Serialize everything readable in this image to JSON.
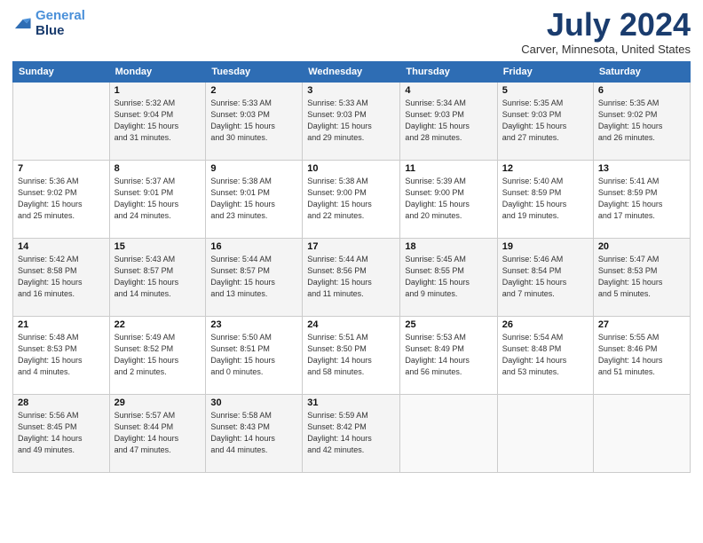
{
  "logo": {
    "line1": "General",
    "line2": "Blue"
  },
  "title": "July 2024",
  "subtitle": "Carver, Minnesota, United States",
  "headers": [
    "Sunday",
    "Monday",
    "Tuesday",
    "Wednesday",
    "Thursday",
    "Friday",
    "Saturday"
  ],
  "weeks": [
    [
      {
        "day": "",
        "info": ""
      },
      {
        "day": "1",
        "info": "Sunrise: 5:32 AM\nSunset: 9:04 PM\nDaylight: 15 hours\nand 31 minutes."
      },
      {
        "day": "2",
        "info": "Sunrise: 5:33 AM\nSunset: 9:03 PM\nDaylight: 15 hours\nand 30 minutes."
      },
      {
        "day": "3",
        "info": "Sunrise: 5:33 AM\nSunset: 9:03 PM\nDaylight: 15 hours\nand 29 minutes."
      },
      {
        "day": "4",
        "info": "Sunrise: 5:34 AM\nSunset: 9:03 PM\nDaylight: 15 hours\nand 28 minutes."
      },
      {
        "day": "5",
        "info": "Sunrise: 5:35 AM\nSunset: 9:03 PM\nDaylight: 15 hours\nand 27 minutes."
      },
      {
        "day": "6",
        "info": "Sunrise: 5:35 AM\nSunset: 9:02 PM\nDaylight: 15 hours\nand 26 minutes."
      }
    ],
    [
      {
        "day": "7",
        "info": "Sunrise: 5:36 AM\nSunset: 9:02 PM\nDaylight: 15 hours\nand 25 minutes."
      },
      {
        "day": "8",
        "info": "Sunrise: 5:37 AM\nSunset: 9:01 PM\nDaylight: 15 hours\nand 24 minutes."
      },
      {
        "day": "9",
        "info": "Sunrise: 5:38 AM\nSunset: 9:01 PM\nDaylight: 15 hours\nand 23 minutes."
      },
      {
        "day": "10",
        "info": "Sunrise: 5:38 AM\nSunset: 9:00 PM\nDaylight: 15 hours\nand 22 minutes."
      },
      {
        "day": "11",
        "info": "Sunrise: 5:39 AM\nSunset: 9:00 PM\nDaylight: 15 hours\nand 20 minutes."
      },
      {
        "day": "12",
        "info": "Sunrise: 5:40 AM\nSunset: 8:59 PM\nDaylight: 15 hours\nand 19 minutes."
      },
      {
        "day": "13",
        "info": "Sunrise: 5:41 AM\nSunset: 8:59 PM\nDaylight: 15 hours\nand 17 minutes."
      }
    ],
    [
      {
        "day": "14",
        "info": "Sunrise: 5:42 AM\nSunset: 8:58 PM\nDaylight: 15 hours\nand 16 minutes."
      },
      {
        "day": "15",
        "info": "Sunrise: 5:43 AM\nSunset: 8:57 PM\nDaylight: 15 hours\nand 14 minutes."
      },
      {
        "day": "16",
        "info": "Sunrise: 5:44 AM\nSunset: 8:57 PM\nDaylight: 15 hours\nand 13 minutes."
      },
      {
        "day": "17",
        "info": "Sunrise: 5:44 AM\nSunset: 8:56 PM\nDaylight: 15 hours\nand 11 minutes."
      },
      {
        "day": "18",
        "info": "Sunrise: 5:45 AM\nSunset: 8:55 PM\nDaylight: 15 hours\nand 9 minutes."
      },
      {
        "day": "19",
        "info": "Sunrise: 5:46 AM\nSunset: 8:54 PM\nDaylight: 15 hours\nand 7 minutes."
      },
      {
        "day": "20",
        "info": "Sunrise: 5:47 AM\nSunset: 8:53 PM\nDaylight: 15 hours\nand 5 minutes."
      }
    ],
    [
      {
        "day": "21",
        "info": "Sunrise: 5:48 AM\nSunset: 8:53 PM\nDaylight: 15 hours\nand 4 minutes."
      },
      {
        "day": "22",
        "info": "Sunrise: 5:49 AM\nSunset: 8:52 PM\nDaylight: 15 hours\nand 2 minutes."
      },
      {
        "day": "23",
        "info": "Sunrise: 5:50 AM\nSunset: 8:51 PM\nDaylight: 15 hours\nand 0 minutes."
      },
      {
        "day": "24",
        "info": "Sunrise: 5:51 AM\nSunset: 8:50 PM\nDaylight: 14 hours\nand 58 minutes."
      },
      {
        "day": "25",
        "info": "Sunrise: 5:53 AM\nSunset: 8:49 PM\nDaylight: 14 hours\nand 56 minutes."
      },
      {
        "day": "26",
        "info": "Sunrise: 5:54 AM\nSunset: 8:48 PM\nDaylight: 14 hours\nand 53 minutes."
      },
      {
        "day": "27",
        "info": "Sunrise: 5:55 AM\nSunset: 8:46 PM\nDaylight: 14 hours\nand 51 minutes."
      }
    ],
    [
      {
        "day": "28",
        "info": "Sunrise: 5:56 AM\nSunset: 8:45 PM\nDaylight: 14 hours\nand 49 minutes."
      },
      {
        "day": "29",
        "info": "Sunrise: 5:57 AM\nSunset: 8:44 PM\nDaylight: 14 hours\nand 47 minutes."
      },
      {
        "day": "30",
        "info": "Sunrise: 5:58 AM\nSunset: 8:43 PM\nDaylight: 14 hours\nand 44 minutes."
      },
      {
        "day": "31",
        "info": "Sunrise: 5:59 AM\nSunset: 8:42 PM\nDaylight: 14 hours\nand 42 minutes."
      },
      {
        "day": "",
        "info": ""
      },
      {
        "day": "",
        "info": ""
      },
      {
        "day": "",
        "info": ""
      }
    ]
  ]
}
